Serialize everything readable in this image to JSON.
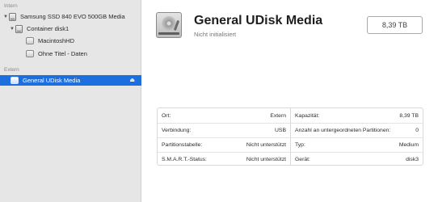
{
  "sidebar": {
    "sections": [
      {
        "label": "Intern"
      },
      {
        "label": "Extern"
      }
    ],
    "items": [
      {
        "label": "Samsung SSD 840 EVO 500GB Media"
      },
      {
        "label": "Container disk1"
      },
      {
        "label": "MacintoshHD"
      },
      {
        "label": "Ohne Titel - Daten"
      },
      {
        "label": "General UDisk Media",
        "selected": true
      }
    ]
  },
  "header": {
    "title": "General UDisk Media",
    "subtitle": "Nicht initialisiert",
    "size": "8,39 TB"
  },
  "info": {
    "left": [
      {
        "key": "Ort:",
        "value": "Extern"
      },
      {
        "key": "Verbindung:",
        "value": "USB"
      },
      {
        "key": "Partitionstabelle:",
        "value": "Nicht unterstützt"
      },
      {
        "key": "S.M.A.R.T.-Status:",
        "value": "Nicht unterstützt"
      }
    ],
    "right": [
      {
        "key": "Kapazität:",
        "value": "8,39 TB"
      },
      {
        "key": "Anzahl an untergeordneten Partitionen:",
        "value": "0"
      },
      {
        "key": "Typ:",
        "value": "Medium"
      },
      {
        "key": "Gerät:",
        "value": "disk3"
      }
    ]
  },
  "colors": {
    "selection": "#1d6fe0",
    "sidebar_bg": "#e6e6e6"
  },
  "icons": [
    "drive-icon",
    "volume-icon",
    "eject-icon",
    "chevron-down-icon",
    "hard-disk-icon"
  ]
}
